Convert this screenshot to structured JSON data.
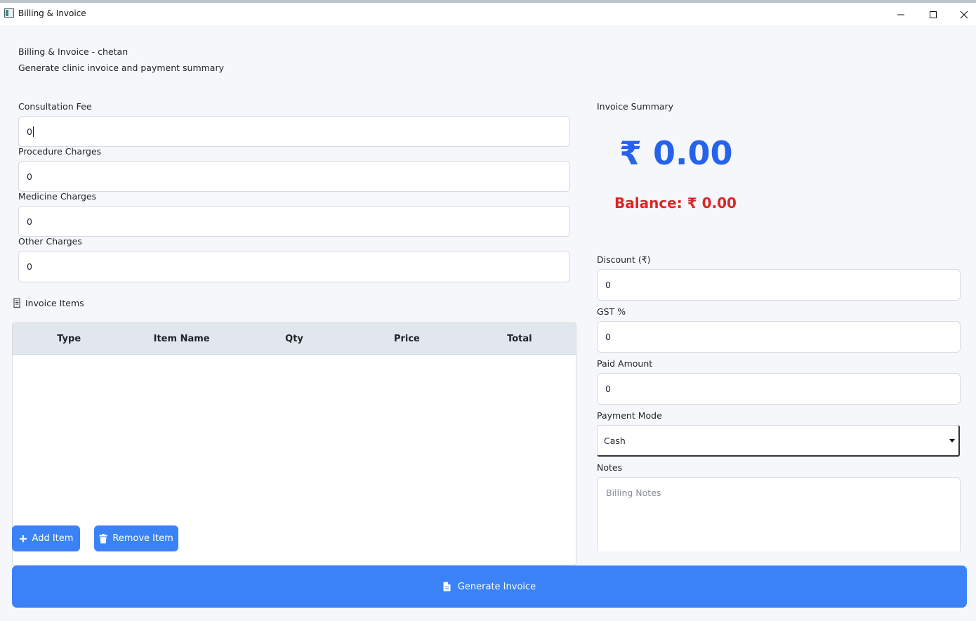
{
  "window": {
    "title": "Billing & Invoice"
  },
  "header": {
    "title": "Billing & Invoice - chetan",
    "subtitle": "Generate clinic invoice and payment summary"
  },
  "charges": {
    "consultation": {
      "label": "Consultation Fee",
      "value": "0"
    },
    "procedure": {
      "label": "Procedure Charges",
      "value": "0"
    },
    "medicine": {
      "label": "Medicine Charges",
      "value": "0"
    },
    "other": {
      "label": "Other Charges",
      "value": "0"
    }
  },
  "items": {
    "label": "Invoice Items",
    "icon": "receipt-icon",
    "columns": [
      "Type",
      "Item Name",
      "Qty",
      "Price",
      "Total"
    ],
    "rows": [],
    "add_label": "Add Item",
    "remove_label": "Remove Item"
  },
  "summary": {
    "title": "Invoice Summary",
    "total": "₹ 0.00",
    "balance": "Balance: ₹ 0.00",
    "total_color": "#2563eb",
    "balance_color": "#dc2626"
  },
  "payment": {
    "discount": {
      "label": "Discount (₹)",
      "value": "0"
    },
    "gst": {
      "label": "GST %",
      "value": "0"
    },
    "paid": {
      "label": "Paid Amount",
      "value": "0"
    },
    "mode": {
      "label": "Payment Mode",
      "value": "Cash"
    },
    "notes": {
      "label": "Notes",
      "placeholder": "Billing Notes"
    }
  },
  "generate_label": "Generate Invoice",
  "colors": {
    "accent": "#3b82f6",
    "background": "#f6f7fb"
  }
}
